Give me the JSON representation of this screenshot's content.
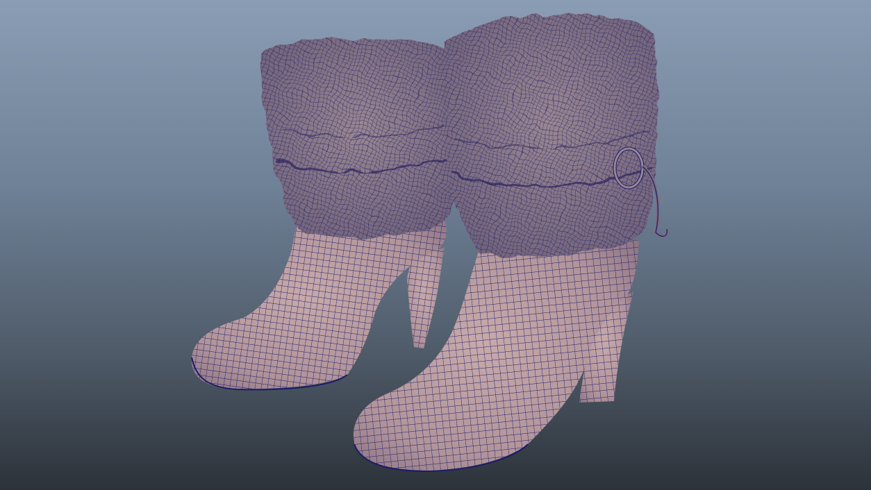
{
  "viewport": {
    "background_top": "#8b9db4",
    "background_bottom": "#2c3239"
  },
  "model": {
    "shading": "wireframe-on-shaded",
    "surface_color": "#b79a9d",
    "fur_color": "#8d7c8b",
    "wire_color": "#1c1d6b",
    "items": [
      {
        "name": "left-boot",
        "icon": "boot-mesh-icon"
      },
      {
        "name": "right-boot",
        "icon": "boot-mesh-icon"
      }
    ]
  }
}
